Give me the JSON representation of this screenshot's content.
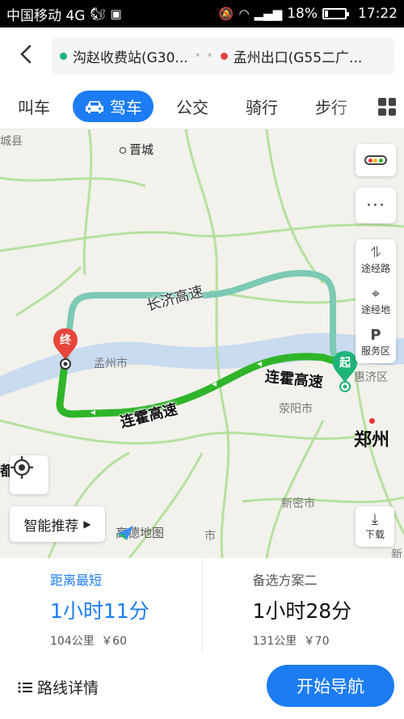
{
  "status_bar": {
    "carrier": "中国移动 4G",
    "battery": "18%",
    "battery_level": 0.18,
    "time": "17:22"
  },
  "route": {
    "start": "沟赵收费站(G30...",
    "end": "孟州出口(G55二广...",
    "start_color": "#1fb37a",
    "end_color": "#e8453c"
  },
  "modes": {
    "items": [
      "叫车",
      "驾车",
      "公交",
      "骑行",
      "步行"
    ],
    "active": "驾车"
  },
  "map": {
    "labels": {
      "jincheng": "晋城",
      "mengzhou": "孟州市",
      "xingyang": "荥阳市",
      "zhengzhou": "郑州",
      "xinmi": "新密市",
      "huixian": "惠济区",
      "cheng_left": "城县",
      "ji": "市",
      "du": "都",
      "right_xin": "新"
    },
    "roads": {
      "changji": "长济高速",
      "lianhuo1": "连霍高速",
      "lianhuo2": "连霍高速"
    },
    "markers": {
      "end": "终",
      "start": "起"
    },
    "colors": {
      "route_main": "#2fb52a",
      "route_alt": "#7cc9b4",
      "river": "#c6d8ee",
      "road": "#b8e2a4"
    }
  },
  "side_panel": {
    "waypoint_road": "途经路",
    "waypoint_place": "途经地",
    "service_area": "服务区"
  },
  "controls": {
    "smart": "智能推荐",
    "logo": "高德地图",
    "download": "下载"
  },
  "plans": [
    {
      "tag": "距离最短",
      "time": "1小时11分",
      "distance": "104公里",
      "toll": "￥60"
    },
    {
      "tag": "备选方案二",
      "time": "1小时28分",
      "distance": "131公里",
      "toll": "￥70"
    }
  ],
  "bottom": {
    "details": "路线详情",
    "start_nav": "开始导航"
  }
}
